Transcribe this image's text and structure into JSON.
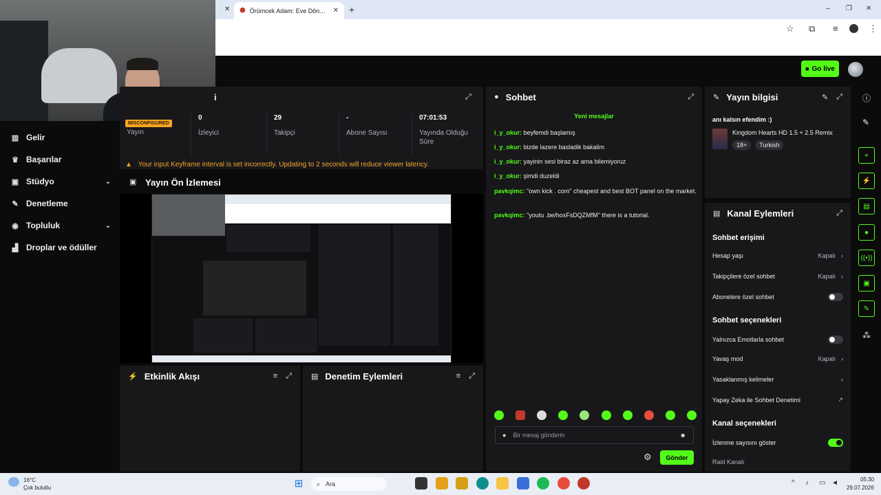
{
  "browser": {
    "tab_title": "Örümcek Adam: Eve Dönüş izle",
    "new_tab": "+",
    "minimize": "–",
    "restore": "❐",
    "close": "✕"
  },
  "header": {
    "go_live_label": "Go live"
  },
  "sidebar": {
    "items": [
      {
        "label": "Gelir",
        "icon": "chart-icon"
      },
      {
        "label": "Başarılar",
        "icon": "trophy-icon"
      },
      {
        "label": "Stüdyo",
        "icon": "studio-icon"
      },
      {
        "label": "Denetleme",
        "icon": "wrench-icon"
      },
      {
        "label": "Topluluk",
        "icon": "community-icon"
      },
      {
        "label": "Droplar ve ödüller",
        "icon": "drops-icon"
      }
    ]
  },
  "stats": {
    "badge": "MISCONFIGURED",
    "title_partial": "i",
    "columns": [
      {
        "value": "",
        "label": "Yayın"
      },
      {
        "value": "0",
        "label": "İzleyici"
      },
      {
        "value": "29",
        "label": "Takipçi"
      },
      {
        "value": "-",
        "label": "Abone Sayısı"
      },
      {
        "value": "07:01:53",
        "label": "Yayında Olduğu Süre"
      }
    ],
    "warning": "Your input Keyframe interval is set incorrectly. Updating to 2 seconds will reduce viewer latency."
  },
  "preview": {
    "title": "Yayın Ön İzlemesi"
  },
  "activity": {
    "title": "Etkinlik Akışı"
  },
  "moderation": {
    "title": "Denetim Eylemleri"
  },
  "chat": {
    "title": "Sohbet",
    "new_messages": "Yeni mesajlar",
    "messages": [
      {
        "user": "i_y_okur:",
        "text": "beyfemdi başlamış"
      },
      {
        "user": "i_y_okur:",
        "text": "bizde lazere basladik bakalim"
      },
      {
        "user": "i_y_okur:",
        "text": "yayinin sesi biraz az ama bilemiyoruz"
      },
      {
        "user": "i_y_okur:",
        "text": "şimdi duzeldi"
      },
      {
        "user": "pavkqimc:",
        "text": "\"own kick . com\" cheapest and best BOT panel on the market."
      },
      {
        "user": "pavkqimc:",
        "text": "\"youtu .be/hoxFsDQZMfM\" there is a tutorial."
      }
    ],
    "input_placeholder": "Bir mesaj gönderin",
    "send_label": "Gönder"
  },
  "stream_info": {
    "title": "Yayın bilgisi",
    "stream_title": "anı kalsın efendim :)",
    "category": "Kingdom Hearts HD 1.5 + 2.5 Remix",
    "tags": [
      "18+",
      "Turkish"
    ]
  },
  "channel_actions": {
    "title": "Kanal Eylemleri",
    "sections": [
      {
        "title": "Sohbet erişimi",
        "rows": [
          {
            "label": "Hesap yaşı",
            "value": "Kapalı",
            "kind": "chevron"
          },
          {
            "label": "Takipçilere özel sohbet",
            "value": "Kapalı",
            "kind": "chevron"
          },
          {
            "label": "Abonelere özel sohbet",
            "value": "",
            "kind": "toggle-off"
          }
        ]
      },
      {
        "title": "Sohbet seçenekleri",
        "rows": [
          {
            "label": "Yalnızca Emotlarla sohbet",
            "value": "",
            "kind": "toggle-off"
          },
          {
            "label": "Yavaş mod",
            "value": "Kapalı",
            "kind": "chevron"
          },
          {
            "label": "Yasaklanmış kelimeler",
            "value": "",
            "kind": "chevron"
          },
          {
            "label": "Yapay Zeka ile Sohbet Denetimi",
            "value": "",
            "kind": "external"
          }
        ]
      },
      {
        "title": "Kanal seçenekleri",
        "rows": [
          {
            "label": "İzlenme sayısını göster",
            "value": "",
            "kind": "toggle-on"
          },
          {
            "label": "Raid Kanalı",
            "value": "",
            "kind": "none"
          }
        ]
      }
    ]
  },
  "taskbar": {
    "weather_temp": "16°C",
    "weather_desc": "Çok bulutlu",
    "search_label": "Ara",
    "time": "05:30",
    "date": "29.07.2026"
  },
  "colors": {
    "accent": "#53fc18",
    "panel": "#18181b",
    "background": "#0b0b0c",
    "warning": "#f5a623"
  }
}
